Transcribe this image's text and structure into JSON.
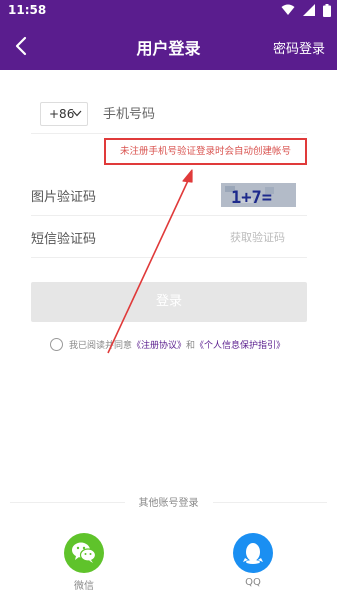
{
  "status_bar": {
    "time": "11:58"
  },
  "header": {
    "title": "用户登录",
    "right_action": "密码登录"
  },
  "phone": {
    "country_code": "+86",
    "placeholder": "手机号码"
  },
  "tip": "未注册手机号验证登录时会自动创建帐号",
  "captcha": {
    "label": "图片验证码",
    "image_text": "1+7="
  },
  "sms": {
    "label": "短信验证码",
    "get_code": "获取验证码"
  },
  "login_button": "登录",
  "agreement": {
    "prefix": "我已阅读并同意",
    "register_link": "《注册协议》",
    "and": "和",
    "privacy_link": "《个人信息保护指引》"
  },
  "other_login": {
    "title": "其他账号登录",
    "options": [
      {
        "label": "微信",
        "icon": "wechat-icon",
        "color": "#5fc32b"
      },
      {
        "label": "QQ",
        "icon": "qq-icon",
        "color": "#1a8ff2"
      }
    ]
  },
  "colors": {
    "brand": "#5a1d8e",
    "annotation": "#e03a3a"
  }
}
